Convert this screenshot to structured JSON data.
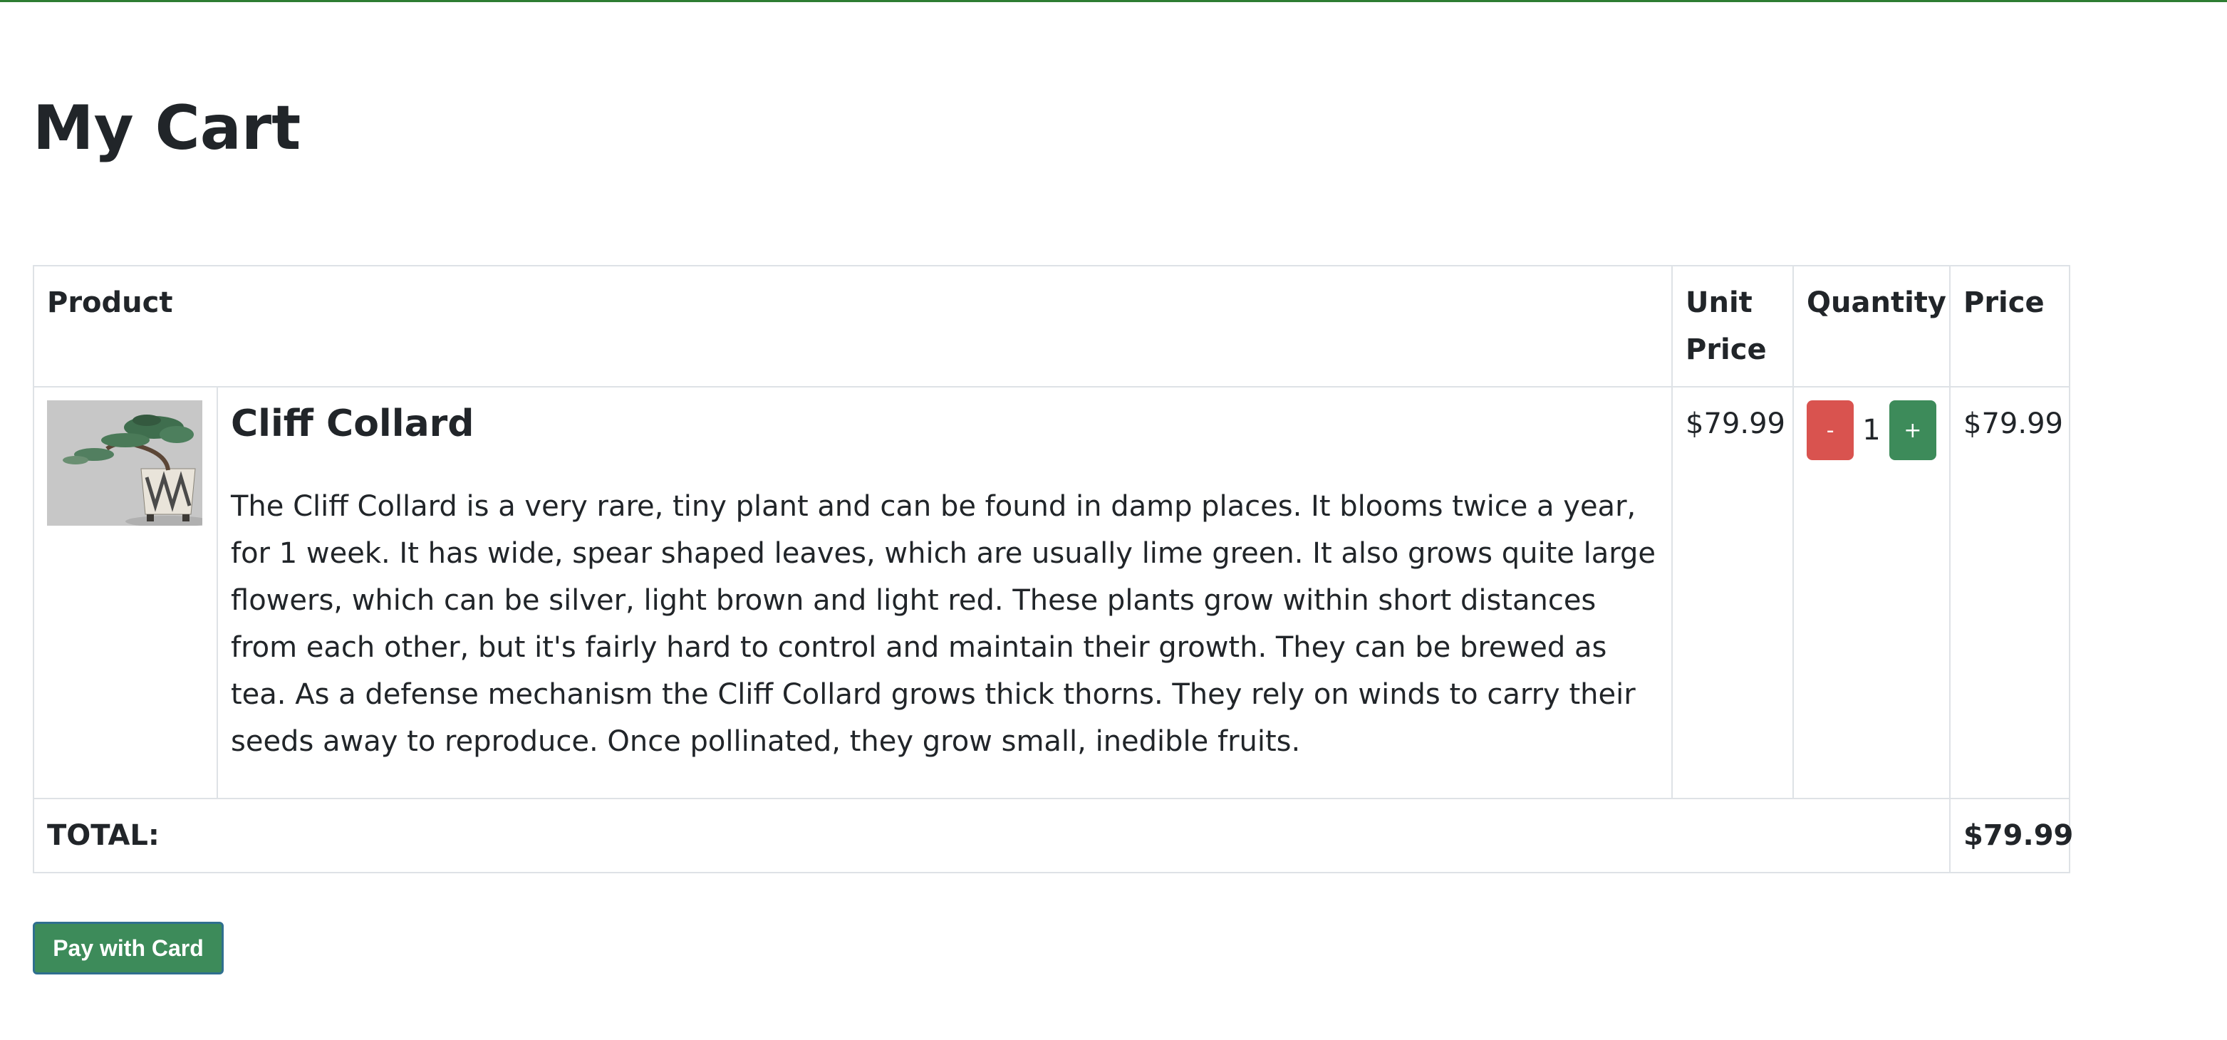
{
  "page": {
    "title": "My Cart"
  },
  "cart": {
    "headers": {
      "product": "Product",
      "unit_price": "Unit Price",
      "quantity": "Quantity",
      "price": "Price"
    },
    "items": [
      {
        "name": "Cliff Collard",
        "description": "The Cliff Collard is a very rare, tiny plant and can be found in damp places. It blooms twice a year, for 1 week. It has wide, spear shaped leaves, which are usually lime green. It also grows quite large flowers, which can be silver, light brown and light red. These plants grow within short distances from each other, but it's fairly hard to control and maintain their growth. They can be brewed as tea. As a defense mechanism the Cliff Collard grows thick thorns. They rely on winds to carry their seeds away to reproduce. Once pollinated, they grow small, inedible fruits.",
        "unit_price": "$79.99",
        "quantity": "1",
        "decrement_label": "-",
        "increment_label": "+",
        "price": "$79.99"
      }
    ],
    "total_label": "TOTAL:",
    "total_value": "$79.99"
  },
  "actions": {
    "pay_label": "Pay with Card"
  },
  "colors": {
    "accent_green": "#3d8b5a",
    "decrement_red": "#d9534f",
    "top_rule": "#2e7d32"
  }
}
